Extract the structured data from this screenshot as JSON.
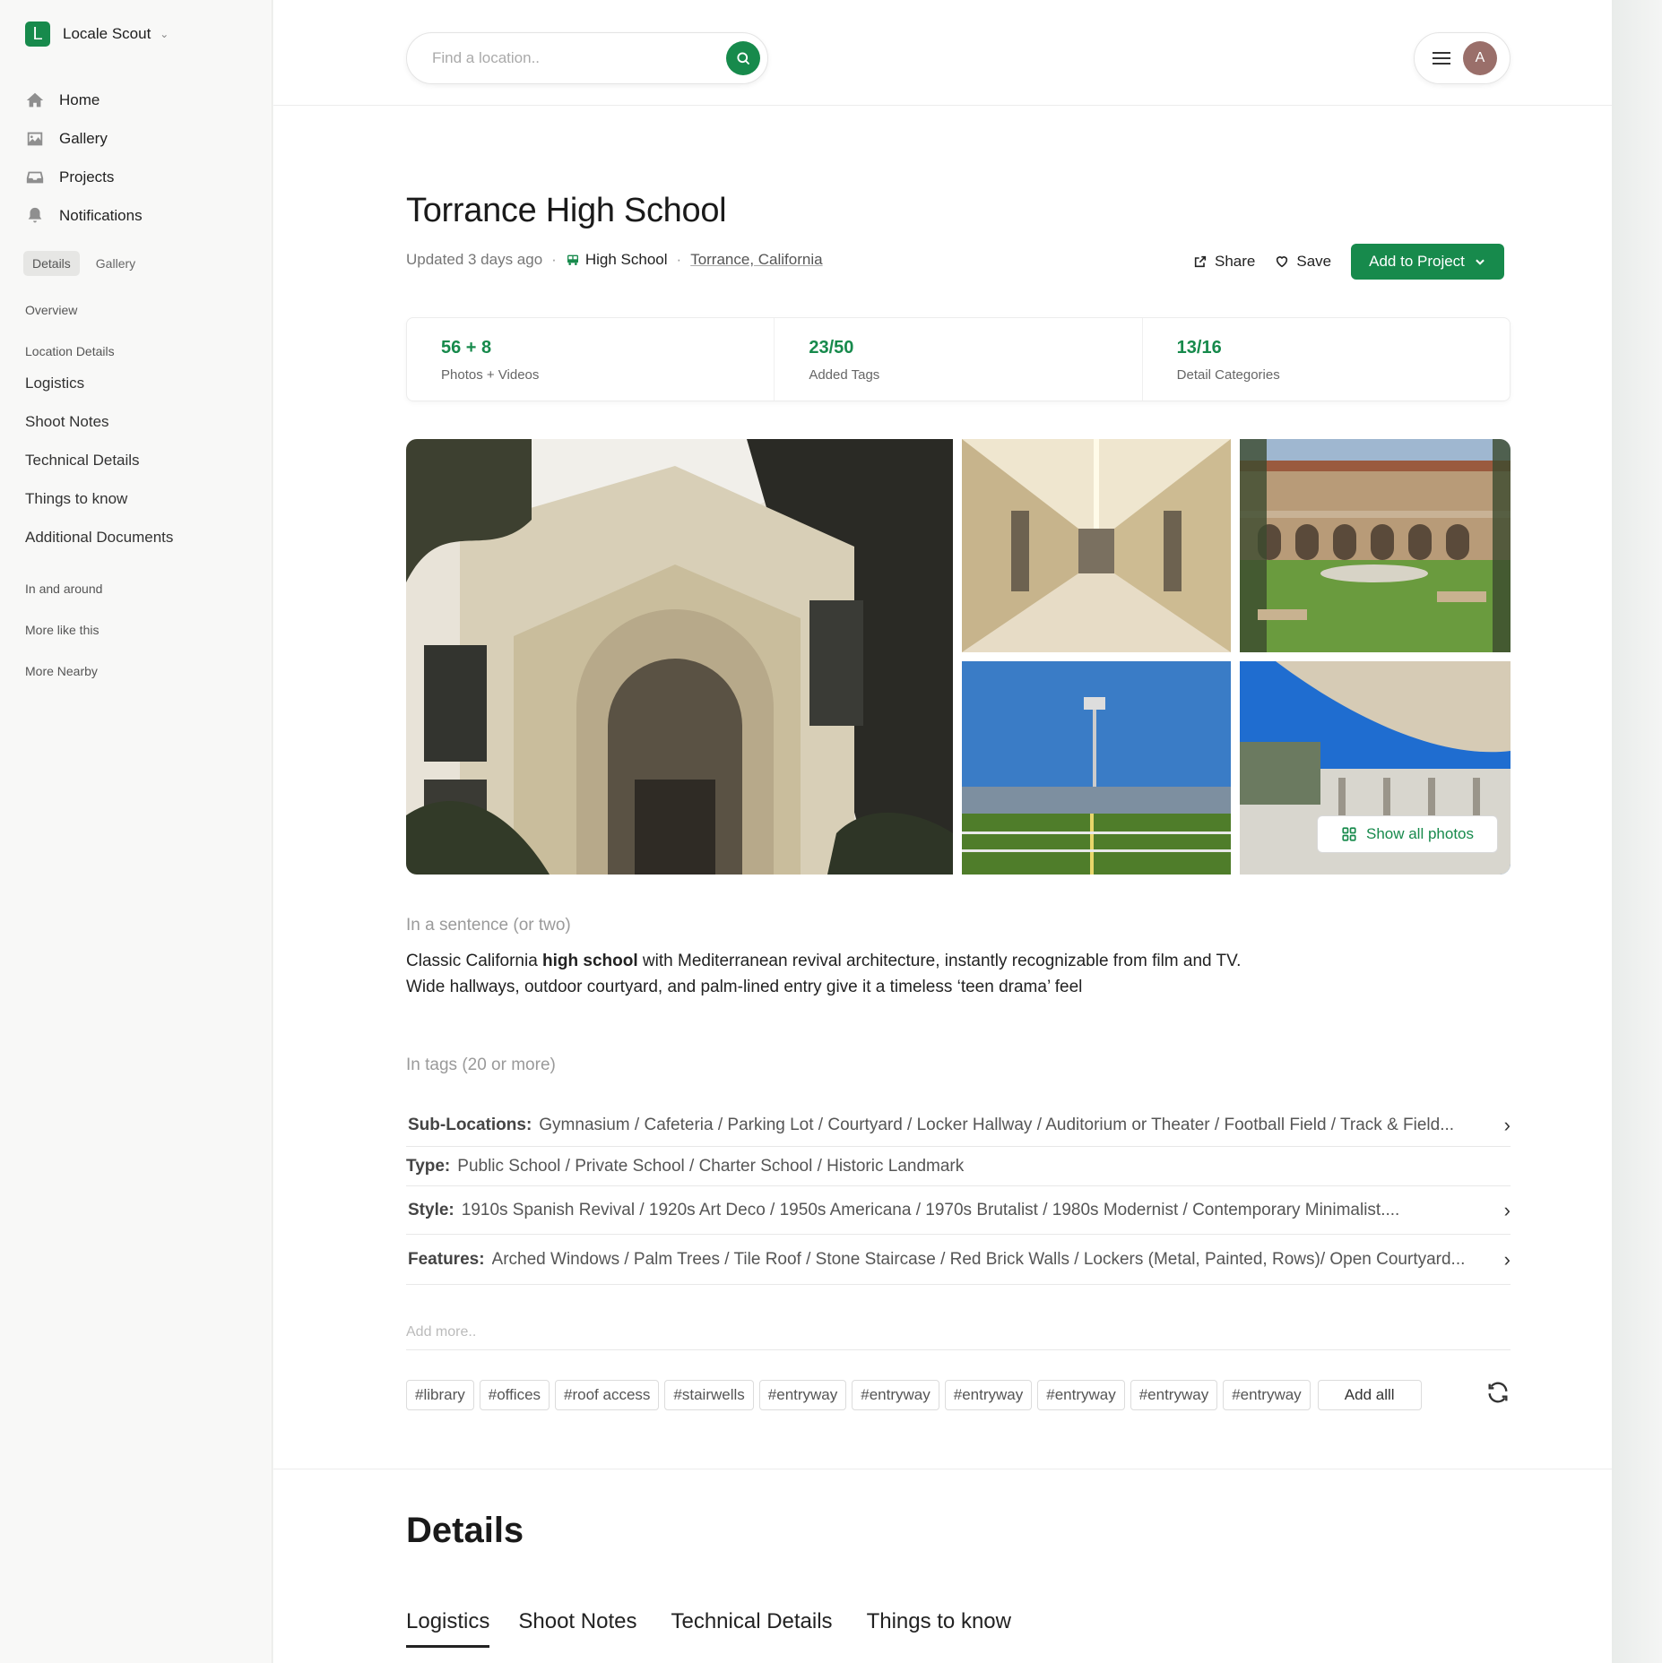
{
  "app": {
    "name": "Locale Scout",
    "logo_letter": "L"
  },
  "sidebar": {
    "nav": [
      {
        "label": "Home",
        "icon": "home-icon"
      },
      {
        "label": "Gallery",
        "icon": "image-icon"
      },
      {
        "label": "Projects",
        "icon": "inbox-icon"
      },
      {
        "label": "Notifications",
        "icon": "bell-icon"
      }
    ],
    "subtabs": [
      "Details",
      "Gallery"
    ],
    "toc": {
      "overview": "Overview",
      "location_details": "Location Details",
      "logistics": "Logistics",
      "shoot_notes": "Shoot Notes",
      "technical_details": "Technical Details",
      "things_to_know": "Things to know",
      "additional_documents": "Additional Documents",
      "in_and_around": "In and around",
      "more_like_this": "More like this",
      "more_nearby": "More Nearby"
    }
  },
  "search": {
    "placeholder": "Find a location.."
  },
  "user": {
    "avatar_letter": "A"
  },
  "location": {
    "title": "Torrance High School",
    "updated": "Updated 3 days ago",
    "type": "High School",
    "place": "Torrance, California"
  },
  "actions": {
    "share": "Share",
    "save": "Save",
    "add_to_project": "Add to Project"
  },
  "stats": [
    {
      "value": "56 + 8",
      "label": "Photos + Videos"
    },
    {
      "value": "23/50",
      "label": "Added Tags"
    },
    {
      "value": "13/16",
      "label": "Detail Categories"
    }
  ],
  "gallery": {
    "show_all": "Show all photos"
  },
  "summary": {
    "label": "In a sentence (or two)",
    "before": "Classic California ",
    "bold": "high school",
    "after": " with Mediterranean revival architecture, instantly recognizable from film and TV. Wide hallways, outdoor courtyard, and palm-lined entry give it a timeless ‘teen drama’ feel"
  },
  "tags": {
    "label": "In tags (20 or more)",
    "rows": [
      {
        "key": "Sub-Locations:",
        "value": "Gymnasium / Cafeteria / Parking Lot / Courtyard / Locker Hallway / Auditorium or Theater / Football Field / Track & Field..."
      },
      {
        "key": "Type:",
        "value": "Public School / Private School / Charter School / Historic Landmark"
      },
      {
        "key": "Style:",
        "value": "1910s Spanish Revival / 1920s Art Deco / 1950s Americana / 1970s Brutalist / 1980s Modernist / Contemporary Minimalist...."
      },
      {
        "key": "Features:",
        "value": "Arched Windows / Palm Trees / Tile Roof / Stone Staircase / Red Brick Walls / Lockers (Metal, Painted, Rows)/ Open Courtyard..."
      }
    ],
    "add_more_placeholder": "Add more..",
    "suggestions": [
      "#library",
      "#offices",
      "#roof access",
      "#stairwells",
      "#entryway",
      "#entryway",
      "#entryway",
      "#entryway",
      "#entryway",
      "#entryway"
    ],
    "add_all": "Add alll"
  },
  "details": {
    "heading": "Details",
    "tabs": [
      "Logistics",
      "Shoot Notes",
      "Technical Details",
      "Things to know"
    ]
  },
  "colors": {
    "accent": "#178a4c",
    "avatar": "#9a6f6a"
  }
}
